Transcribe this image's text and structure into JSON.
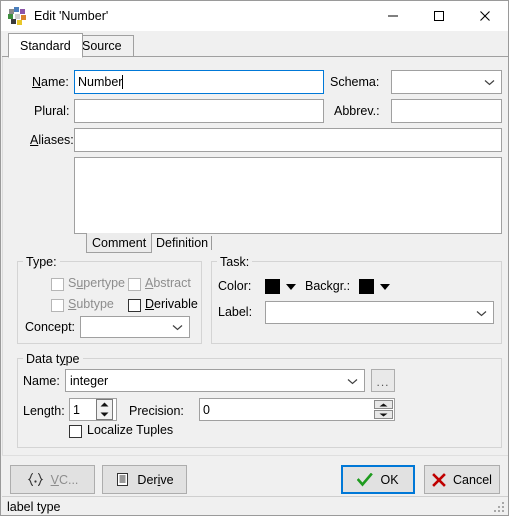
{
  "window": {
    "title": "Edit 'Number'",
    "icon": "flower-dots-icon",
    "controls": {
      "minimize": "minimize-icon",
      "maximize": "maximize-icon",
      "close": "close-icon"
    }
  },
  "tabs": [
    {
      "label": "Standard",
      "active": true
    },
    {
      "label": "Source",
      "active": false
    }
  ],
  "form": {
    "name": {
      "label": "Name:",
      "accel": "N",
      "value": "Number",
      "focused": true
    },
    "schema": {
      "label": "Schema:",
      "value": "",
      "options": []
    },
    "plural": {
      "label": "Plural:",
      "value": ""
    },
    "abbrev": {
      "label": "Abbrev.:",
      "value": ""
    },
    "aliases": {
      "label": "Aliases:",
      "accel": "A",
      "value": ""
    },
    "notes": {
      "value": ""
    }
  },
  "notes_tabs": [
    {
      "label": "Comment",
      "active": true
    },
    {
      "label": "Definition",
      "active": false
    }
  ],
  "type_group": {
    "title": "Type:",
    "checkboxes": [
      {
        "label": "Supertype",
        "accel": "u",
        "checked": false,
        "enabled": false
      },
      {
        "label": "Abstract",
        "accel": "A",
        "checked": false,
        "enabled": false
      },
      {
        "label": "Subtype",
        "accel": "S",
        "checked": false,
        "enabled": false
      },
      {
        "label": "Derivable",
        "accel": "D",
        "checked": false,
        "enabled": true
      }
    ],
    "concept": {
      "label": "Concept:",
      "value": "",
      "options": []
    }
  },
  "task_group": {
    "title": "Task:",
    "color": {
      "label": "Color:",
      "value": "#000000"
    },
    "background": {
      "label": "Backgr.:",
      "value": "#000000"
    },
    "label_field": {
      "label": "Label:",
      "value": "",
      "options": []
    }
  },
  "datatype_group": {
    "title": "Data type",
    "accel": "y",
    "name": {
      "label": "Name:",
      "value": "integer",
      "options": [
        "integer"
      ]
    },
    "browse_button": "...",
    "length": {
      "label": "Length:",
      "value": "1"
    },
    "precision": {
      "label": "Precision:",
      "value": "0"
    },
    "localize": {
      "label": "Localize Tuples",
      "checked": false
    }
  },
  "buttons": {
    "vc": {
      "label": "VC...",
      "accel": "V",
      "icon": "braces-icon",
      "enabled": false
    },
    "derive": {
      "label": "Derive",
      "accel": "i",
      "icon": "list-document-icon",
      "enabled": true
    },
    "ok": {
      "label": "OK",
      "icon": "green-check-icon",
      "focused": true
    },
    "cancel": {
      "label": "Cancel",
      "icon": "red-x-icon"
    }
  },
  "statusbar": {
    "text": "label type"
  },
  "colors": {
    "window_bg": "#f0f0f0",
    "field_bg": "#ffffff",
    "accent": "#0078d7",
    "border": "#a0a0a0",
    "disabled_text": "#8d8d8d",
    "ok_check": "#1f9b1f",
    "cancel_x": "#c00000"
  }
}
